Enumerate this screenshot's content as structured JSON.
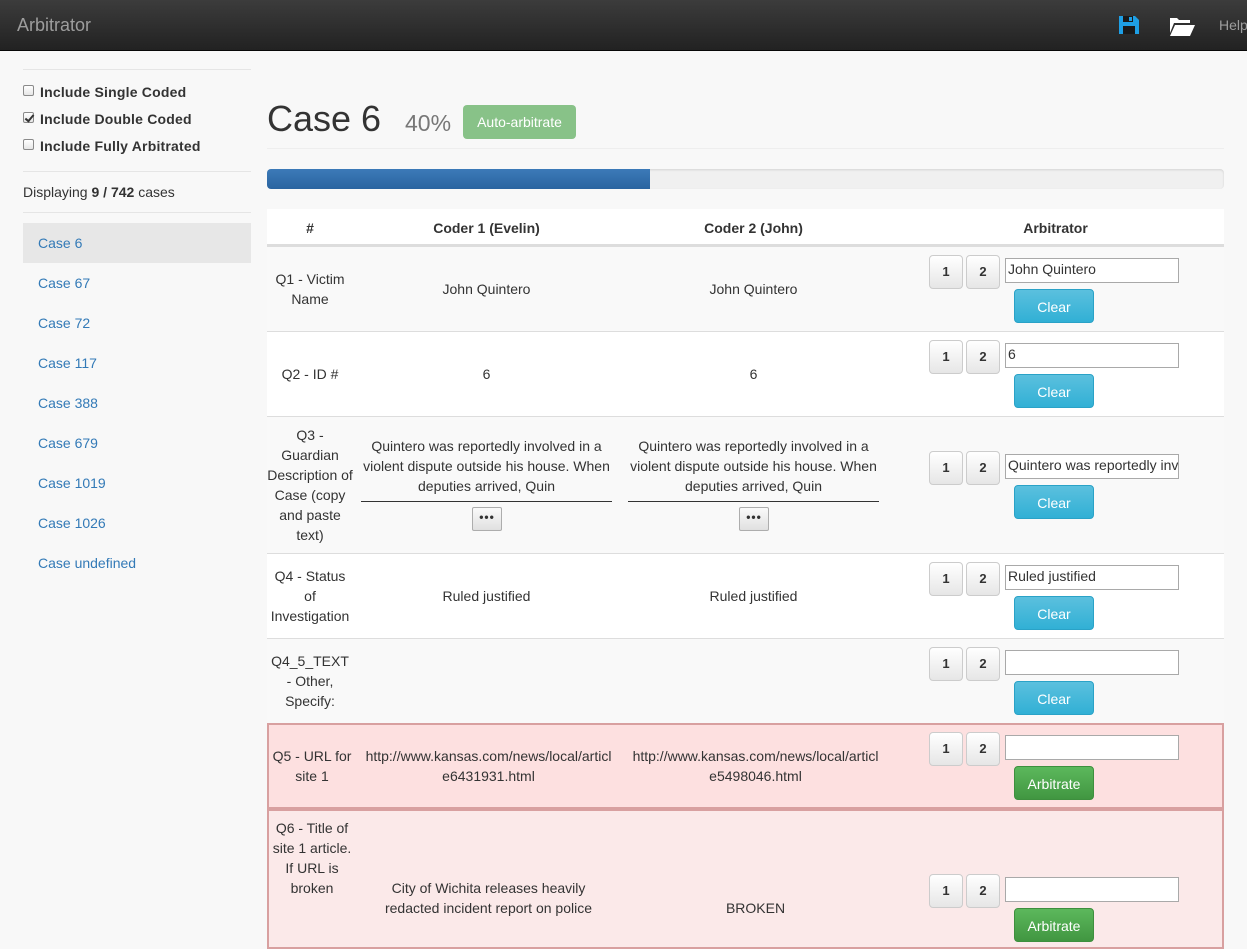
{
  "navbar": {
    "brand": "Arbitrator",
    "save_icon": "floppy-disk-icon",
    "open_icon": "folder-open-icon",
    "help": "Help",
    "save_icon_color": "#1e9fe5"
  },
  "sidebar": {
    "filters": [
      {
        "label": "Include Single Coded",
        "checked": false
      },
      {
        "label": "Include Double Coded",
        "checked": true
      },
      {
        "label": "Include Fully Arbitrated",
        "checked": false
      }
    ],
    "displaying_prefix": "Displaying",
    "displaying_count": "9 / 742",
    "displaying_suffix": "cases",
    "cases": [
      "Case 6",
      "Case 67",
      "Case 72",
      "Case 117",
      "Case 388",
      "Case 679",
      "Case 1019",
      "Case 1026",
      "Case undefined"
    ],
    "active_case": "Case 6"
  },
  "main": {
    "title": "Case 6",
    "percent": "40%",
    "progress": 0.4,
    "auto_arbitrate_label": "Auto-arbitrate",
    "columns": [
      "#",
      "Coder 1 (Evelin)",
      "Coder 2 (John)",
      "Arbitrator"
    ],
    "choice_1": "1",
    "choice_2": "2",
    "more_label": "•••",
    "rows": [
      {
        "label": "Q1 - Victim Name",
        "coder1": "John Quintero",
        "coder2": "John Quintero",
        "arbitrated": "John Quintero",
        "action": "Clear"
      },
      {
        "label": "Q2 - ID #",
        "coder1": "6",
        "coder2": "6",
        "arbitrated": "6",
        "action": "Clear"
      },
      {
        "label": "Q3 - Guardian Description of Case (copy and paste text)",
        "coder1": "Quintero was reportedly involved in a violent dispute outside his house. When deputies arrived, Quin",
        "coder2": "Quintero was reportedly involved in a violent dispute outside his house. When deputies arrived, Quin",
        "arbitrated": "Quintero was reportedly inv",
        "action": "Clear"
      },
      {
        "label": "Q4 - Status of Investigation",
        "coder1": "Ruled justified",
        "coder2": "Ruled justified",
        "arbitrated": "Ruled justified",
        "action": "Clear"
      },
      {
        "label": "Q4_5_TEXT - Other, Specify:",
        "coder1": "",
        "coder2": "",
        "arbitrated": "",
        "action": "Clear"
      },
      {
        "label": "Q5 - URL for site 1",
        "coder1": "http://www.kansas.com/news/local/article6431931.html",
        "coder2": "http://www.kansas.com/news/local/article5498046.html",
        "arbitrated": "",
        "action": "Arbitrate"
      },
      {
        "label": "Q6 - Title of site 1 article. If URL is broken",
        "coder1": "City of Wichita releases heavily redacted incident report on police",
        "coder2": "BROKEN",
        "arbitrated": "",
        "action": "Arbitrate"
      }
    ]
  }
}
